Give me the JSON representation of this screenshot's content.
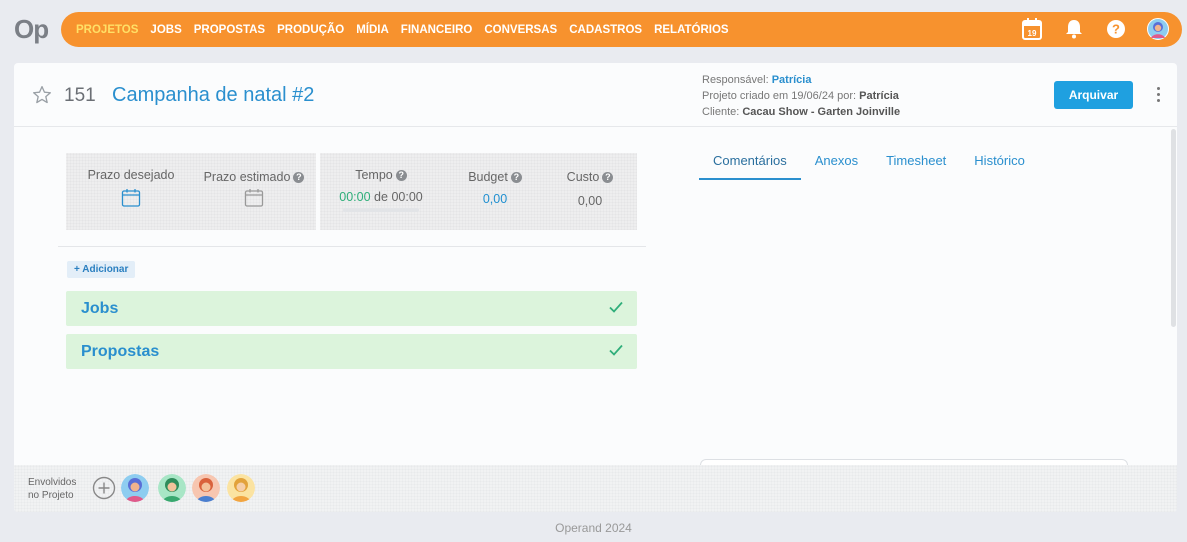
{
  "brand": {
    "logo_text": "Op"
  },
  "nav": {
    "items": [
      {
        "label": "PROJETOS",
        "active": true
      },
      {
        "label": "JOBS"
      },
      {
        "label": "PROPOSTAS"
      },
      {
        "label": "PRODUÇÃO"
      },
      {
        "label": "MÍDIA"
      },
      {
        "label": "FINANCEIRO"
      },
      {
        "label": "CONVERSAS"
      },
      {
        "label": "CADASTROS"
      },
      {
        "label": "RELATÓRIOS"
      }
    ],
    "calendar_day": "19",
    "icons": [
      "calendar-icon",
      "bell-icon",
      "help-icon",
      "user-avatar"
    ]
  },
  "project": {
    "number": "151",
    "title": "Campanha de natal #2",
    "responsible_label": "Responsável:",
    "responsible": "Patrícia",
    "created_label": "Projeto criado em 19/06/24 por:",
    "created_by": "Patrícia",
    "client_label": "Cliente:",
    "client": "Cacau Show - Garten Joinville",
    "archive_label": "Arquivar"
  },
  "stats": {
    "prazo_desejado": "Prazo desejado",
    "prazo_estimado": "Prazo estimado",
    "tempo_label": "Tempo",
    "tempo_spent": "00:00",
    "tempo_sep": "de",
    "tempo_total": "00:00",
    "budget_label": "Budget",
    "budget_value": "0,00",
    "custo_label": "Custo",
    "custo_value": "0,00"
  },
  "add_label": "+ Adicionar",
  "sections": [
    {
      "name": "Jobs"
    },
    {
      "name": "Propostas"
    }
  ],
  "tabs": [
    {
      "label": "Comentários",
      "active": true
    },
    {
      "label": "Anexos"
    },
    {
      "label": "Timesheet"
    },
    {
      "label": "Histórico"
    }
  ],
  "involved": {
    "label_line1": "Envolvidos",
    "label_line2": "no Projeto"
  },
  "footer": {
    "copyright": "Operand 2024"
  },
  "colors": {
    "accent": "#f7922e",
    "primary": "#2a8fce",
    "success": "#dcf4dc"
  }
}
